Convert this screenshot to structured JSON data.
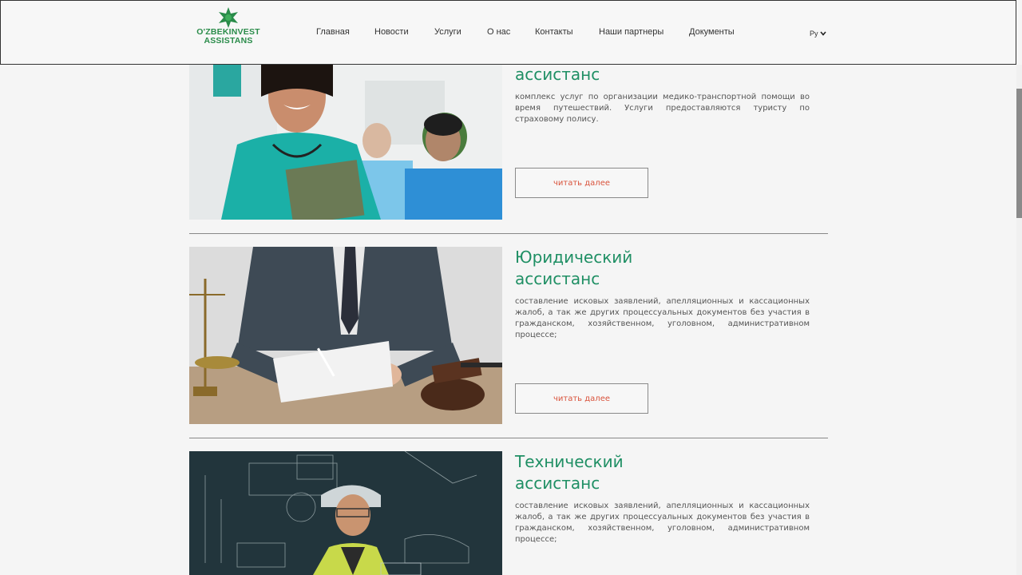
{
  "header": {
    "logo_line1": "O'ZBEKINVEST",
    "logo_line2": "ASSISTANS",
    "nav": [
      "Главная",
      "Новости",
      "Услуги",
      "О нас",
      "Контакты",
      "Наши партнеры",
      "Документы"
    ],
    "lang": "Ру"
  },
  "cards": [
    {
      "title_line1": "",
      "title_line2": "ассистанс",
      "description": "комплекс услуг по организации медико-транспортной помощи во время путешествий. Услуги предоставляются туристу по страховому полису.",
      "button": "читать далее"
    },
    {
      "title_line1": "Юридический",
      "title_line2": "ассистанс",
      "description": "составление исковых заявлений, апелляционных и кассационных жалоб, а так же других процессуальных документов без участия в гражданском, хозяйственном, уголовном, административном процессе;",
      "button": "читать далее"
    },
    {
      "title_line1": "Технический",
      "title_line2": "ассистанс",
      "description": "составление исковых заявлений, апелляционных и кассационных жалоб, а так же других процессуальных документов без участия в гражданском, хозяйственном, уголовном, административном процессе;"
    }
  ],
  "colors": {
    "brand_green": "#2a8c4a",
    "title_green": "#1f8f64",
    "button_text": "#d9533c"
  }
}
